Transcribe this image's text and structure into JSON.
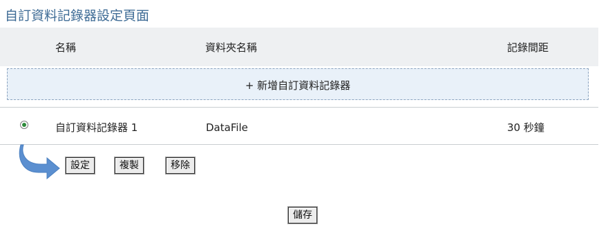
{
  "page": {
    "title": "自訂資料記錄器設定頁面"
  },
  "table": {
    "headers": {
      "name": "名稱",
      "folder": "資料夾名稱",
      "interval": "記錄間距"
    },
    "add_label": "+ 新增自訂資料記錄器",
    "rows": [
      {
        "name": "自訂資料記錄器 1",
        "folder": "DataFile",
        "interval": "30 秒鐘",
        "selected": true
      }
    ]
  },
  "actions": {
    "settings": "設定",
    "copy": "複製",
    "remove": "移除"
  },
  "save_label": "儲存",
  "colors": {
    "title": "#3f6c96",
    "header_bg": "#eef0f2",
    "add_bg": "#e9f1f9",
    "arrow": "#5b8fd0"
  }
}
